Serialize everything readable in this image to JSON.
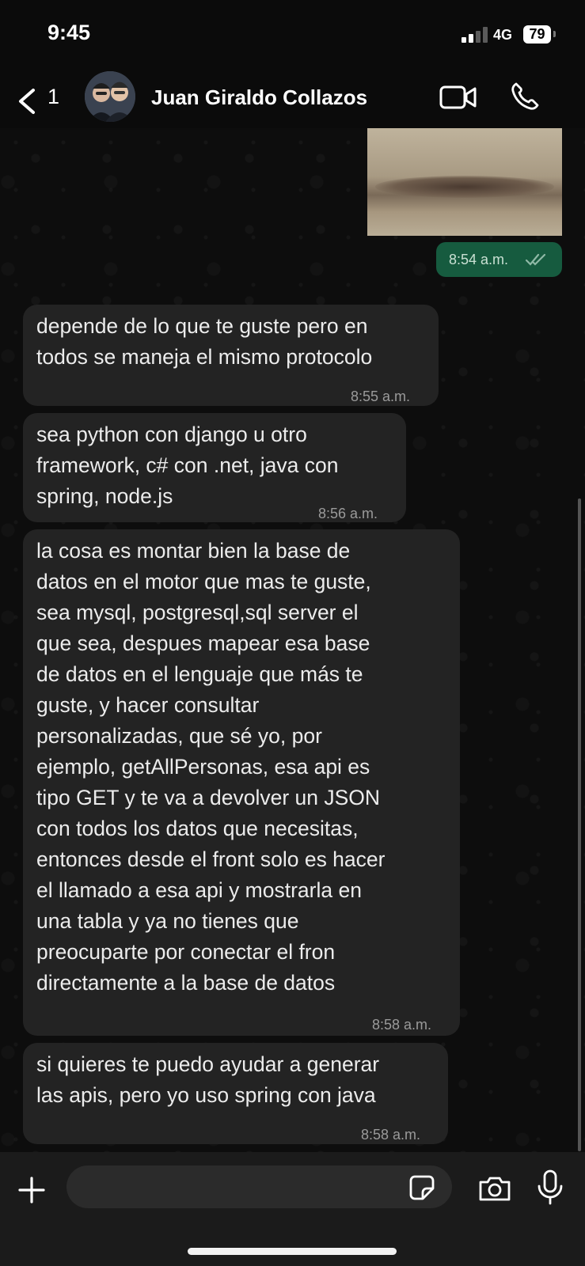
{
  "status_bar": {
    "time": "9:45",
    "network": "4G",
    "battery": "79"
  },
  "header": {
    "unread_count": "1",
    "contact_name": "Juan Giraldo Collazos"
  },
  "outgoing": {
    "media_time": "8:54 a.m."
  },
  "messages": [
    {
      "text": "depende de lo que te guste pero en\ntodos se maneja el mismo protocolo",
      "time": "8:55 a.m."
    },
    {
      "text": "sea python con django u otro\nframework, c# con .net, java con\nspring, node.js",
      "time": "8:56 a.m."
    },
    {
      "text": "la cosa es montar bien la base de\ndatos en el motor que mas te guste,\nsea mysql, postgresql,sql server el\nque sea, despues mapear esa base\nde datos en el lenguaje que más te\nguste, y hacer consultar\npersonalizadas, que sé yo, por\nejemplo, getAllPersonas, esa api es\ntipo GET y te va a devolver un JSON\ncon todos los datos que necesitas,\nentonces desde el front solo es hacer\nel llamado a esa api y mostrarla en\nuna tabla y ya no tienes que\npreocuparte por conectar el fron\ndirectamente a la base de datos",
      "time": "8:58 a.m."
    },
    {
      "text": "si quieres te puedo ayudar a generar\nlas apis, pero yo uso spring con java",
      "time": "8:58 a.m."
    }
  ],
  "input": {
    "placeholder": ""
  },
  "colors": {
    "outgoing_bubble": "#165b3f",
    "incoming_bubble": "#232323",
    "read_ticks": "#8fb9a6"
  }
}
